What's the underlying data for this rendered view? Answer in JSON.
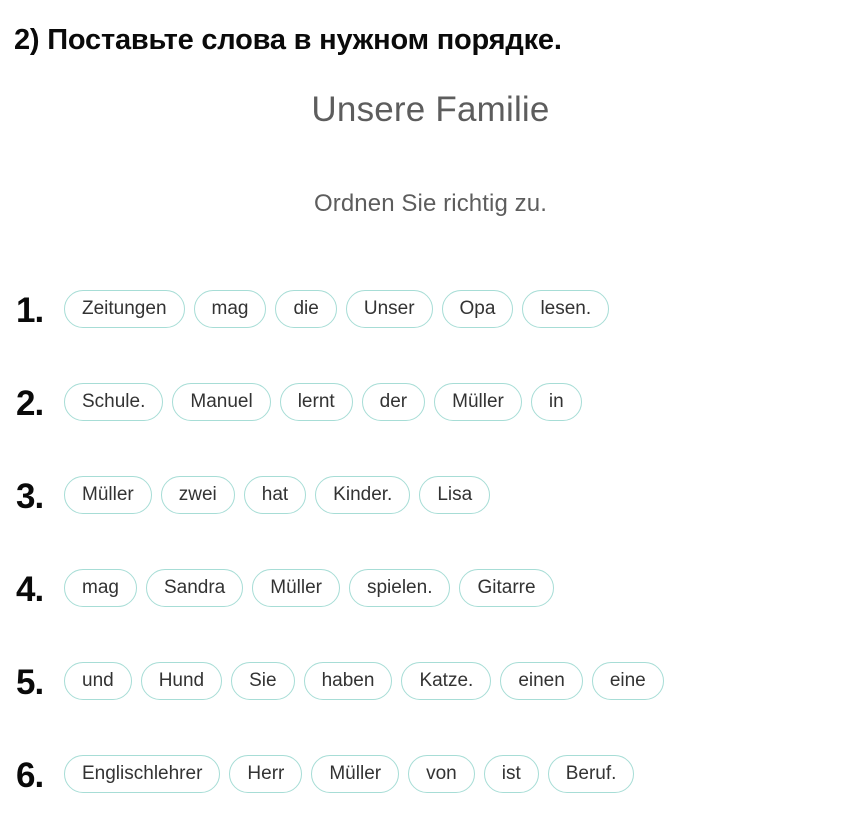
{
  "task": {
    "instruction": "2) Поставьте слова в нужном порядке."
  },
  "worksheet": {
    "title": "Unsere Familie",
    "subtitle": "Ordnen Sie richtig zu."
  },
  "style": {
    "chip_border_color": "#a7ddd6",
    "chip_text_color": "#333333",
    "heading_color": "#5d5d5d",
    "number_color": "#0a0a0a",
    "background": "#ffffff"
  },
  "exercises": [
    {
      "number": "1.",
      "words": [
        "Zeitungen",
        "mag",
        "die",
        "Unser",
        "Opa",
        "lesen."
      ]
    },
    {
      "number": "2.",
      "words": [
        "Schule.",
        "Manuel",
        "lernt",
        "der",
        "Müller",
        "in"
      ]
    },
    {
      "number": "3.",
      "words": [
        "Müller",
        "zwei",
        "hat",
        "Kinder.",
        "Lisa"
      ]
    },
    {
      "number": "4.",
      "words": [
        "mag",
        "Sandra",
        "Müller",
        "spielen.",
        "Gitarre"
      ]
    },
    {
      "number": "5.",
      "words": [
        "und",
        "Hund",
        "Sie",
        "haben",
        "Katze.",
        "einen",
        "eine"
      ]
    },
    {
      "number": "6.",
      "words": [
        "Englischlehrer",
        "Herr",
        "Müller",
        "von",
        "ist",
        "Beruf."
      ]
    }
  ]
}
